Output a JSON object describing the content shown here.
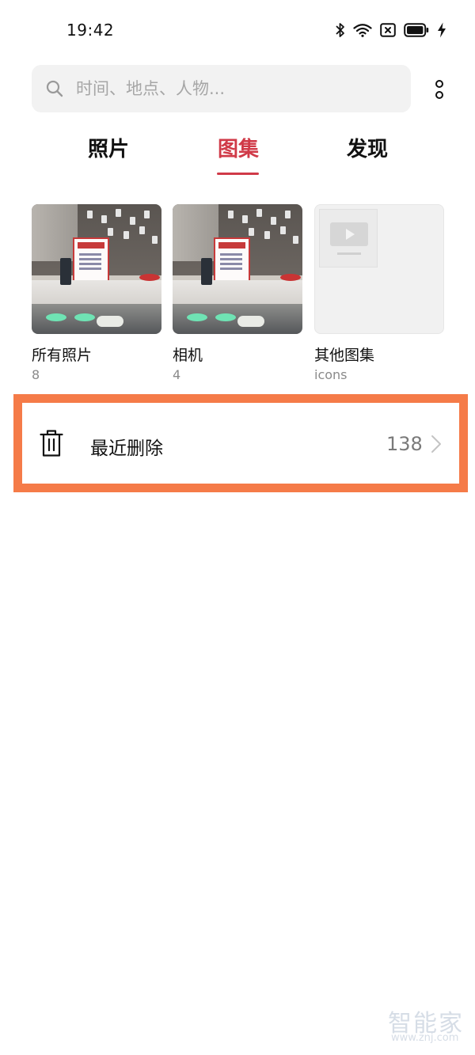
{
  "status_bar": {
    "time": "19:42",
    "icons": [
      "bluetooth-icon",
      "wifi-icon",
      "sim-blocked-icon",
      "battery-icon",
      "charging-icon"
    ]
  },
  "search": {
    "placeholder": "时间、地点、人物..."
  },
  "tabs": [
    {
      "label": "照片",
      "active": false
    },
    {
      "label": "图集",
      "active": true
    },
    {
      "label": "发现",
      "active": false
    }
  ],
  "albums": [
    {
      "name": "所有照片",
      "count": "8",
      "cover": "photo"
    },
    {
      "name": "相机",
      "count": "4",
      "cover": "photo"
    },
    {
      "name": "其他图集",
      "count": "icons",
      "cover": "video-placeholder"
    }
  ],
  "recently_deleted": {
    "label": "最近删除",
    "count": "138",
    "icon": "trash-icon",
    "highlight_color": "#f57b48"
  },
  "watermark": {
    "logo": "智能家",
    "url": "www.znj.com"
  },
  "colors": {
    "accent": "#d03a48",
    "search_bg": "#f2f2f2",
    "secondary_text": "#8a8a8a"
  }
}
